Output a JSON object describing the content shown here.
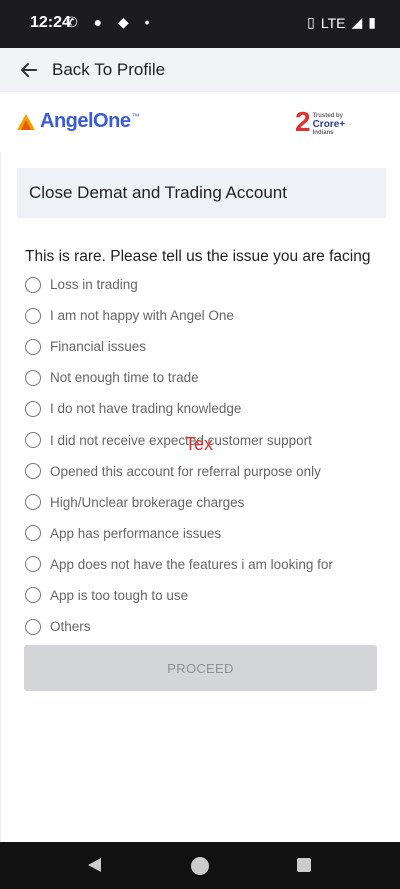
{
  "status_bar": {
    "time": "12:24",
    "left_icons": [
      "whatsapp-icon",
      "chat-bubble-icon",
      "location-icon",
      "dot-icon"
    ],
    "network": "LTE"
  },
  "header": {
    "back_label": "Back To Profile"
  },
  "brand": {
    "logo_text": "AngelOne",
    "logo_tm": "™",
    "badge_number": "2",
    "badge_small": "Trusted by",
    "badge_text": "Crore+",
    "badge_sub": "Indians"
  },
  "section": {
    "title": "Close Demat and Trading Account",
    "question": "This is rare. Please tell us the issue you are facing"
  },
  "options": [
    "Loss in trading",
    "I am not happy with Angel One",
    "Financial issues",
    "Not enough time to trade",
    "I do not have trading knowledge",
    "I did not receive expected customer support",
    "Opened this account for referral purpose only",
    "High/Unclear brokerage charges",
    "App has performance issues",
    "App does not have the features i am looking for",
    "App is too tough to use",
    "Others"
  ],
  "overlay_text": "Tex",
  "proceed_label": "PROCEED",
  "colors": {
    "brand_blue": "#3b5bdb",
    "accent_red": "#e03131",
    "disabled_button": "#d4d5d8"
  }
}
